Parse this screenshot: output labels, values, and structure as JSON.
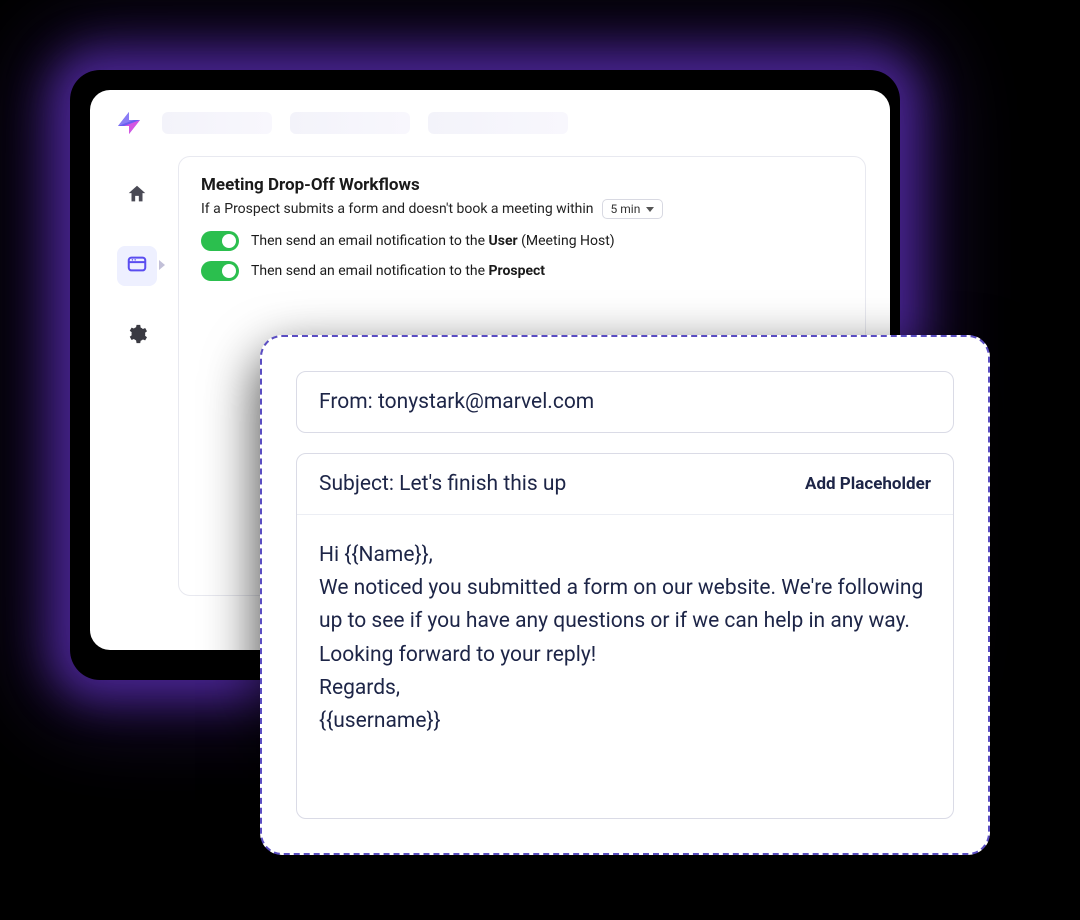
{
  "workflow": {
    "title": "Meeting Drop-Off Workflows",
    "subtitle": "If a Prospect submits a form and doesn't book a meeting within",
    "dropdown_value": "5 min",
    "rule1_prefix": "Then send an email notification to the ",
    "rule1_bold": "User",
    "rule1_suffix": " (Meeting Host)",
    "rule2_prefix": "Then send an email notification to the ",
    "rule2_bold": "Prospect"
  },
  "email": {
    "from_label": "From: ",
    "from_value": "tonystark@marvel.com",
    "subject_label": "Subject: ",
    "subject_value": "Let's finish this up",
    "add_placeholder": "Add Placeholder",
    "body": "Hi {{Name}},\nWe noticed you submitted a form on our website. We're following up to see if you have any questions or if we can help in any way.\nLooking forward to your reply!\nRegards,\n{{username}}"
  }
}
